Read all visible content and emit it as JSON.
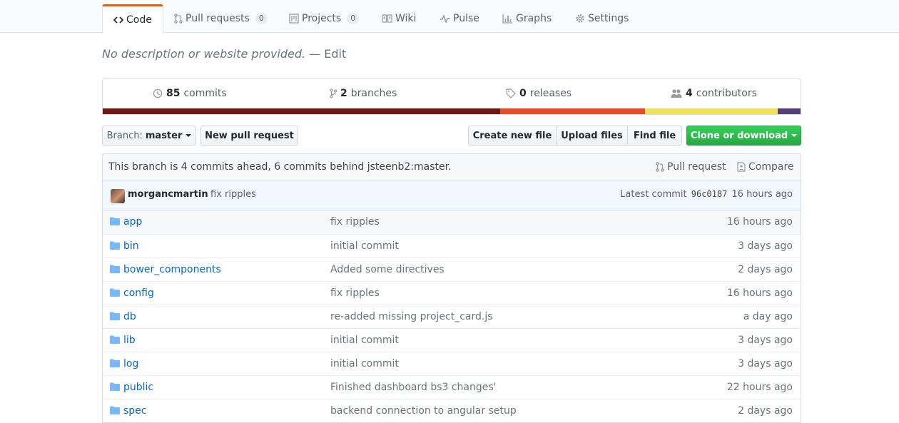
{
  "tabs": [
    {
      "label": "Code",
      "icon": "code-icon"
    },
    {
      "label": "Pull requests",
      "icon": "pull-request-icon",
      "count": "0"
    },
    {
      "label": "Projects",
      "icon": "project-icon",
      "count": "0"
    },
    {
      "label": "Wiki",
      "icon": "book-icon"
    },
    {
      "label": "Pulse",
      "icon": "pulse-icon"
    },
    {
      "label": "Graphs",
      "icon": "graph-icon"
    },
    {
      "label": "Settings",
      "icon": "gear-icon"
    }
  ],
  "description": {
    "text": "No description or website provided.",
    "edit": "— Edit"
  },
  "summary": {
    "commits": {
      "count": "85",
      "label": "commits"
    },
    "branches": {
      "count": "2",
      "label": "branches"
    },
    "releases": {
      "count": "0",
      "label": "releases"
    },
    "contributors": {
      "count": "4",
      "label": "contributors"
    }
  },
  "languages": [
    {
      "share": 0.57,
      "color": "#701516"
    },
    {
      "share": 0.207,
      "color": "#e34c26"
    },
    {
      "share": 0.19,
      "color": "#f1e05a"
    },
    {
      "share": 0.033,
      "color": "#563d7c"
    }
  ],
  "toolbar": {
    "branch_prefix": "Branch:",
    "branch_name": "master",
    "new_pull_request": "New pull request",
    "create_new_file": "Create new file",
    "upload_files": "Upload files",
    "find_file": "Find file",
    "clone_or_download": "Clone or download"
  },
  "branch_info": {
    "text": "This branch is 4 commits ahead, 6 commits behind jsteenb2:master.",
    "pull_request": "Pull request",
    "compare": "Compare"
  },
  "latest_commit": {
    "author": "morgancmartin",
    "message": "fix ripples",
    "prefix": "Latest commit",
    "sha": "96c0187",
    "age": "16 hours ago"
  },
  "files": [
    {
      "name": "app",
      "message": "fix ripples",
      "age": "16 hours ago"
    },
    {
      "name": "bin",
      "message": "initial commit",
      "age": "3 days ago"
    },
    {
      "name": "bower_components",
      "message": "Added some directives",
      "age": "2 days ago"
    },
    {
      "name": "config",
      "message": "fix ripples",
      "age": "16 hours ago"
    },
    {
      "name": "db",
      "message": "re-added missing project_card.js",
      "age": "a day ago"
    },
    {
      "name": "lib",
      "message": "initial commit",
      "age": "3 days ago"
    },
    {
      "name": "log",
      "message": "initial commit",
      "age": "3 days ago"
    },
    {
      "name": "public",
      "message": "Finished dashboard bs3 changes'",
      "age": "22 hours ago"
    },
    {
      "name": "spec",
      "message": "backend connection to angular setup",
      "age": "2 days ago"
    }
  ]
}
